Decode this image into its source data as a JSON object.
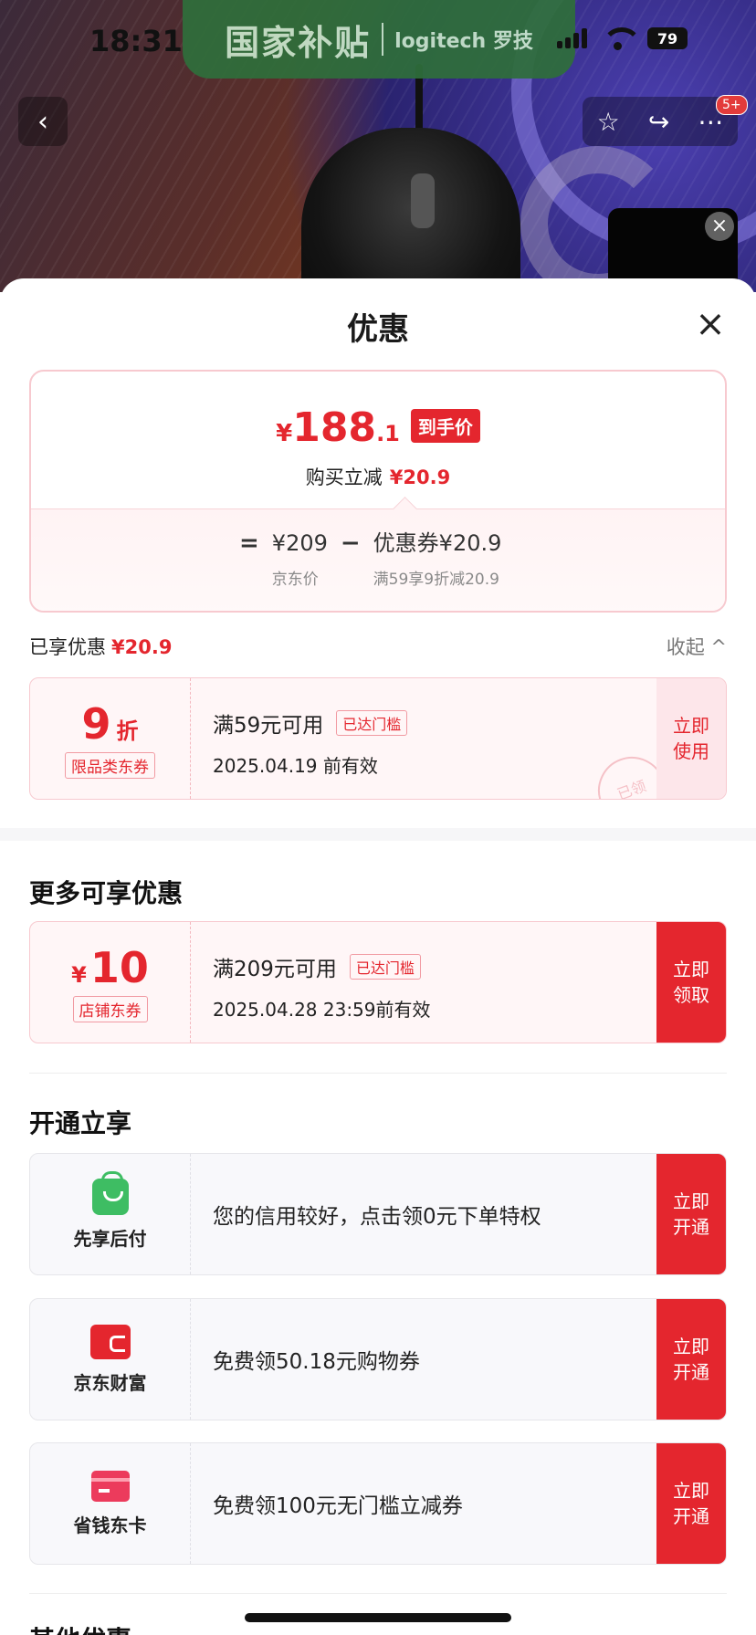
{
  "status_bar": {
    "time": "18:31",
    "battery": "79"
  },
  "banner": {
    "title": "国家补贴",
    "brand": "logitech 罗技"
  },
  "nav": {
    "badge": "5+"
  },
  "sheet": {
    "title": "优惠"
  },
  "price_summary": {
    "currency": "¥",
    "price_int": "188",
    "price_dec": ".1",
    "price_tag": "到手价",
    "instant_label": "购买立减",
    "instant_amount": "¥20.9",
    "formula": {
      "eq": "=",
      "jd_price": "¥209",
      "jd_price_label": "京东价",
      "minus": "−",
      "coupon": "优惠券¥20.9",
      "coupon_label": "满59享9折减20.9"
    }
  },
  "enjoyed": {
    "label": "已享优惠",
    "amount": "¥20.9",
    "collapse": "收起"
  },
  "enjoyed_coupon": {
    "value": "9",
    "suffix": "折",
    "tag": "限品类东券",
    "title": "满59元可用",
    "reach": "已达门槛",
    "date": "2025.04.19 前有效",
    "action": "立即使用",
    "stamp": "已领"
  },
  "more_section": {
    "title": "更多可享优惠"
  },
  "more_coupon": {
    "currency": "¥",
    "value": "10",
    "tag": "店铺东券",
    "title": "满209元可用",
    "reach": "已达门槛",
    "date": "2025.04.28 23:59前有效",
    "action": "立即领取"
  },
  "open_section": {
    "title": "开通立享"
  },
  "services": [
    {
      "icon": "shopping-bag-icon",
      "label": "先享后付",
      "desc": "您的信用较好，点击领0元下单特权",
      "action": "立即开通"
    },
    {
      "icon": "wallet-icon",
      "label": "京东财富",
      "desc": "免费领50.18元购物券",
      "action": "立即开通"
    },
    {
      "icon": "card-icon",
      "label": "省钱东卡",
      "desc": "免费领100元无门槛立减券",
      "action": "立即开通"
    }
  ],
  "other_section": {
    "title": "其他优惠"
  }
}
